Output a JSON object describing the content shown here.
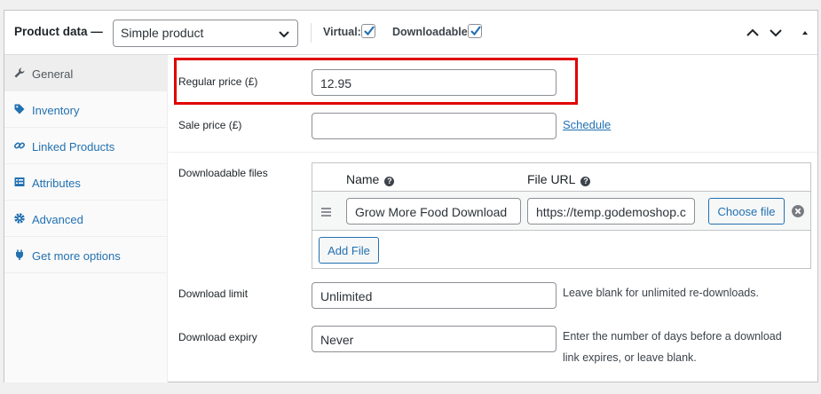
{
  "header": {
    "title": "Product data —",
    "product_type": "Simple product",
    "virtual_label": "Virtual:",
    "virtual_checked": true,
    "downloadable_label": "Downloadable:",
    "downloadable_checked": true
  },
  "sidebar": {
    "items": [
      {
        "label": "General",
        "icon": "wrench-icon",
        "active": true
      },
      {
        "label": "Inventory",
        "icon": "tag-icon",
        "active": false
      },
      {
        "label": "Linked Products",
        "icon": "link-icon",
        "active": false
      },
      {
        "label": "Attributes",
        "icon": "table-icon",
        "active": false
      },
      {
        "label": "Advanced",
        "icon": "gear-icon",
        "active": false
      },
      {
        "label": "Get more options",
        "icon": "plugin-icon",
        "active": false
      }
    ]
  },
  "pricing": {
    "regular_price_label": "Regular price (£)",
    "regular_price_value": "12.95",
    "sale_price_label": "Sale price (£)",
    "sale_price_value": "",
    "schedule_link": "Schedule"
  },
  "downloads": {
    "label": "Downloadable files",
    "col_name": "Name",
    "col_url": "File URL",
    "files": [
      {
        "name": "Grow More Food Download",
        "url": "https://temp.godemoshop.c"
      }
    ],
    "choose_file_label": "Choose file",
    "add_file_label": "Add File"
  },
  "download_limit": {
    "label": "Download limit",
    "value": "Unlimited",
    "help": "Leave blank for unlimited re-downloads."
  },
  "download_expiry": {
    "label": "Download expiry",
    "value": "Never",
    "help_line1": "Enter the number of days before a download",
    "help_line2": "link expires, or leave blank."
  },
  "colors": {
    "accent": "#2271b1",
    "highlight": "#e00000"
  }
}
